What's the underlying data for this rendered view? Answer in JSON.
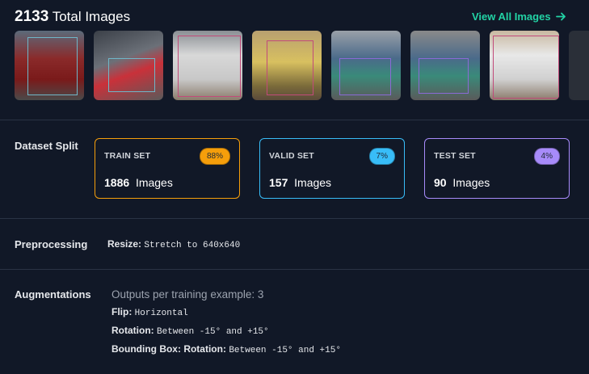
{
  "header": {
    "total_count": "2133",
    "total_label": "Total Images",
    "view_all_label": "View All Images",
    "view_all_icon": "arrow-right-icon"
  },
  "thumbnails": [
    {
      "alt": "red bus"
    },
    {
      "alt": "red city bus"
    },
    {
      "alt": "white hatchback car"
    },
    {
      "alt": "auto rickshaw"
    },
    {
      "alt": "decorated truck"
    },
    {
      "alt": "decorated truck"
    },
    {
      "alt": "white car"
    }
  ],
  "dataset_split": {
    "label": "Dataset Split",
    "cards": [
      {
        "name": "TRAIN SET",
        "percent": "88%",
        "count": "1886",
        "unit": "Images",
        "color": "#f59e0b"
      },
      {
        "name": "VALID SET",
        "percent": "7%",
        "count": "157",
        "unit": "Images",
        "color": "#38bdf8"
      },
      {
        "name": "TEST SET",
        "percent": "4%",
        "count": "90",
        "unit": "Images",
        "color": "#a78bfa"
      }
    ]
  },
  "preprocessing": {
    "label": "Preprocessing",
    "resize_key": "Resize:",
    "resize_value": "Stretch to 640x640"
  },
  "augmentations": {
    "label": "Augmentations",
    "outputs": "Outputs per training example: 3",
    "flip_key": "Flip:",
    "flip_value": "Horizontal",
    "rotation_key": "Rotation:",
    "rotation_value": "Between -15° and +15°",
    "bbox_rotation_key": "Bounding Box: Rotation:",
    "bbox_rotation_value": "Between -15° and +15°"
  },
  "colors": {
    "background": "#111827",
    "accent": "#22d3a5",
    "train": "#f59e0b",
    "valid": "#38bdf8",
    "test": "#a78bfa"
  }
}
